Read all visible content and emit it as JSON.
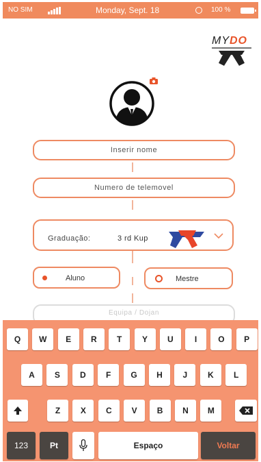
{
  "status_bar": {
    "carrier": "NO SIM",
    "date": "Monday, Sept. 18",
    "battery": "100 %",
    "color": "#f08a5d",
    "icons": [
      "signal-icon",
      "clock-icon",
      "battery-icon"
    ]
  },
  "logo": {
    "text_prefix": "MY",
    "text_accent": "DO"
  },
  "form": {
    "name_placeholder": "Inserir nome",
    "phone_placeholder": "Numero de telemovel",
    "graduation_label": "Graduação:",
    "graduation_value": "3 rd Kup",
    "role_student": "Aluno",
    "role_master": "Mestre",
    "selected_role": "Aluno",
    "team_placeholder": "Equipa / Dojan",
    "accent_color": "#ee8a62"
  },
  "keyboard": {
    "row1": [
      "Q",
      "W",
      "E",
      "R",
      "T",
      "Y",
      "U",
      "I",
      "O",
      "P"
    ],
    "row2": [
      "A",
      "S",
      "D",
      "F",
      "G",
      "H",
      "J",
      "K",
      "L"
    ],
    "row3": [
      "Z",
      "X",
      "C",
      "V",
      "B",
      "N",
      "M"
    ],
    "numbers_key": "123",
    "language_key": "Pt",
    "space_key": "Espaço",
    "return_key": "Voltar",
    "background": "#f59470"
  }
}
